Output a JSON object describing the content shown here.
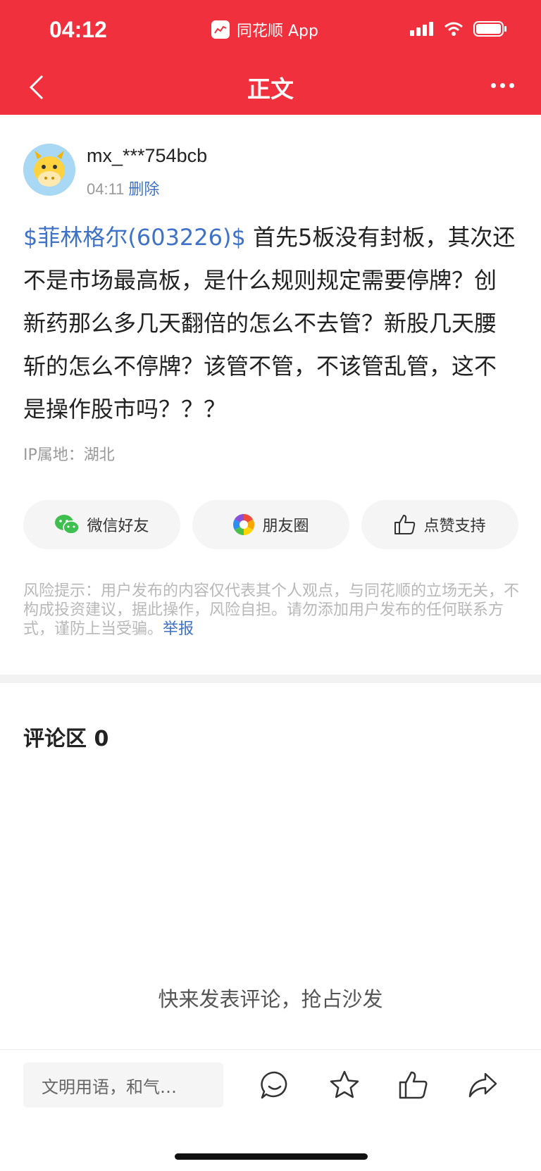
{
  "status_bar": {
    "time": "04:12",
    "app_name": "同花顺 App",
    "icons": [
      "signal-icon",
      "wifi-icon",
      "battery-icon"
    ]
  },
  "nav": {
    "title": "正文",
    "back_icon": "chevron-left-icon",
    "more_icon": "more-dots-icon"
  },
  "author": {
    "name": "mx_***754bcb",
    "time": "04:11",
    "delete_label": "删除"
  },
  "post": {
    "stock_tag": "$菲林格尔(603226)$",
    "text": " 首先5板没有封板，其次还不是市场最高板，是什么规则规定需要停牌？创新药那么多几天翻倍的怎么不去管？新股几天腰斩的怎么不停牌？该管不管，不该管乱管，这不是操作股市吗？？？",
    "ip_location": "IP属地：湖北"
  },
  "share": {
    "wechat_label": "微信好友",
    "moments_label": "朋友圈",
    "like_label": "点赞支持"
  },
  "disclaimer": {
    "text": "风险提示：用户发布的内容仅代表其个人观点，与同花顺的立场无关，不构成投资建议，据此操作，风险自担。请勿添加用户发布的任何联系方式，谨防上当受骗。",
    "report_label": "举报"
  },
  "comments": {
    "title": "评论区 0",
    "empty_text": "快来发表评论，抢占沙发"
  },
  "bottom_bar": {
    "input_placeholder": "文明用语，和气…",
    "icons": [
      "comment-icon",
      "star-icon",
      "thumbs-up-icon",
      "share-icon"
    ]
  },
  "colors": {
    "brand_red": "#f0303c",
    "link_blue": "#3e72c8"
  }
}
